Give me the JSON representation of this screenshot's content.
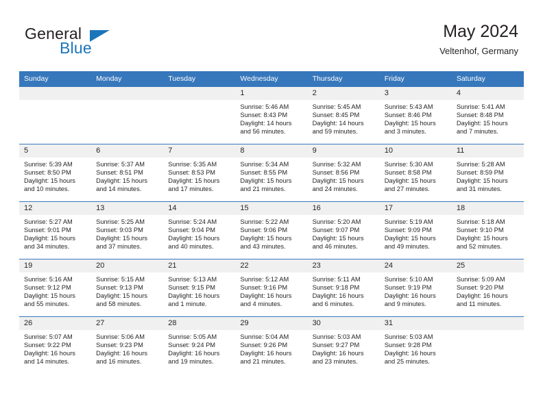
{
  "brand": {
    "word_one": "General",
    "word_two": "Blue",
    "logo_icon": "blue-triangle-logo"
  },
  "header": {
    "title": "May 2024",
    "subtitle": "Veltenhof, Germany"
  },
  "theme": {
    "header_blue": "#3777bc",
    "brand_blue": "#1b75bb",
    "daynum_bg": "#f0f0f0",
    "text": "#231f20"
  },
  "calendar": {
    "weekday_headers": [
      "Sunday",
      "Monday",
      "Tuesday",
      "Wednesday",
      "Thursday",
      "Friday",
      "Saturday"
    ],
    "weeks": [
      [
        {
          "day": "",
          "empty": true,
          "sunrise": "",
          "sunset": "",
          "daylight_line1": "",
          "daylight_line2": ""
        },
        {
          "day": "",
          "empty": true,
          "sunrise": "",
          "sunset": "",
          "daylight_line1": "",
          "daylight_line2": ""
        },
        {
          "day": "",
          "empty": true,
          "sunrise": "",
          "sunset": "",
          "daylight_line1": "",
          "daylight_line2": ""
        },
        {
          "day": "1",
          "empty": false,
          "sunrise": "Sunrise: 5:46 AM",
          "sunset": "Sunset: 8:43 PM",
          "daylight_line1": "Daylight: 14 hours",
          "daylight_line2": "and 56 minutes."
        },
        {
          "day": "2",
          "empty": false,
          "sunrise": "Sunrise: 5:45 AM",
          "sunset": "Sunset: 8:45 PM",
          "daylight_line1": "Daylight: 14 hours",
          "daylight_line2": "and 59 minutes."
        },
        {
          "day": "3",
          "empty": false,
          "sunrise": "Sunrise: 5:43 AM",
          "sunset": "Sunset: 8:46 PM",
          "daylight_line1": "Daylight: 15 hours",
          "daylight_line2": "and 3 minutes."
        },
        {
          "day": "4",
          "empty": false,
          "sunrise": "Sunrise: 5:41 AM",
          "sunset": "Sunset: 8:48 PM",
          "daylight_line1": "Daylight: 15 hours",
          "daylight_line2": "and 7 minutes."
        }
      ],
      [
        {
          "day": "5",
          "empty": false,
          "sunrise": "Sunrise: 5:39 AM",
          "sunset": "Sunset: 8:50 PM",
          "daylight_line1": "Daylight: 15 hours",
          "daylight_line2": "and 10 minutes."
        },
        {
          "day": "6",
          "empty": false,
          "sunrise": "Sunrise: 5:37 AM",
          "sunset": "Sunset: 8:51 PM",
          "daylight_line1": "Daylight: 15 hours",
          "daylight_line2": "and 14 minutes."
        },
        {
          "day": "7",
          "empty": false,
          "sunrise": "Sunrise: 5:35 AM",
          "sunset": "Sunset: 8:53 PM",
          "daylight_line1": "Daylight: 15 hours",
          "daylight_line2": "and 17 minutes."
        },
        {
          "day": "8",
          "empty": false,
          "sunrise": "Sunrise: 5:34 AM",
          "sunset": "Sunset: 8:55 PM",
          "daylight_line1": "Daylight: 15 hours",
          "daylight_line2": "and 21 minutes."
        },
        {
          "day": "9",
          "empty": false,
          "sunrise": "Sunrise: 5:32 AM",
          "sunset": "Sunset: 8:56 PM",
          "daylight_line1": "Daylight: 15 hours",
          "daylight_line2": "and 24 minutes."
        },
        {
          "day": "10",
          "empty": false,
          "sunrise": "Sunrise: 5:30 AM",
          "sunset": "Sunset: 8:58 PM",
          "daylight_line1": "Daylight: 15 hours",
          "daylight_line2": "and 27 minutes."
        },
        {
          "day": "11",
          "empty": false,
          "sunrise": "Sunrise: 5:28 AM",
          "sunset": "Sunset: 8:59 PM",
          "daylight_line1": "Daylight: 15 hours",
          "daylight_line2": "and 31 minutes."
        }
      ],
      [
        {
          "day": "12",
          "empty": false,
          "sunrise": "Sunrise: 5:27 AM",
          "sunset": "Sunset: 9:01 PM",
          "daylight_line1": "Daylight: 15 hours",
          "daylight_line2": "and 34 minutes."
        },
        {
          "day": "13",
          "empty": false,
          "sunrise": "Sunrise: 5:25 AM",
          "sunset": "Sunset: 9:03 PM",
          "daylight_line1": "Daylight: 15 hours",
          "daylight_line2": "and 37 minutes."
        },
        {
          "day": "14",
          "empty": false,
          "sunrise": "Sunrise: 5:24 AM",
          "sunset": "Sunset: 9:04 PM",
          "daylight_line1": "Daylight: 15 hours",
          "daylight_line2": "and 40 minutes."
        },
        {
          "day": "15",
          "empty": false,
          "sunrise": "Sunrise: 5:22 AM",
          "sunset": "Sunset: 9:06 PM",
          "daylight_line1": "Daylight: 15 hours",
          "daylight_line2": "and 43 minutes."
        },
        {
          "day": "16",
          "empty": false,
          "sunrise": "Sunrise: 5:20 AM",
          "sunset": "Sunset: 9:07 PM",
          "daylight_line1": "Daylight: 15 hours",
          "daylight_line2": "and 46 minutes."
        },
        {
          "day": "17",
          "empty": false,
          "sunrise": "Sunrise: 5:19 AM",
          "sunset": "Sunset: 9:09 PM",
          "daylight_line1": "Daylight: 15 hours",
          "daylight_line2": "and 49 minutes."
        },
        {
          "day": "18",
          "empty": false,
          "sunrise": "Sunrise: 5:18 AM",
          "sunset": "Sunset: 9:10 PM",
          "daylight_line1": "Daylight: 15 hours",
          "daylight_line2": "and 52 minutes."
        }
      ],
      [
        {
          "day": "19",
          "empty": false,
          "sunrise": "Sunrise: 5:16 AM",
          "sunset": "Sunset: 9:12 PM",
          "daylight_line1": "Daylight: 15 hours",
          "daylight_line2": "and 55 minutes."
        },
        {
          "day": "20",
          "empty": false,
          "sunrise": "Sunrise: 5:15 AM",
          "sunset": "Sunset: 9:13 PM",
          "daylight_line1": "Daylight: 15 hours",
          "daylight_line2": "and 58 minutes."
        },
        {
          "day": "21",
          "empty": false,
          "sunrise": "Sunrise: 5:13 AM",
          "sunset": "Sunset: 9:15 PM",
          "daylight_line1": "Daylight: 16 hours",
          "daylight_line2": "and 1 minute."
        },
        {
          "day": "22",
          "empty": false,
          "sunrise": "Sunrise: 5:12 AM",
          "sunset": "Sunset: 9:16 PM",
          "daylight_line1": "Daylight: 16 hours",
          "daylight_line2": "and 4 minutes."
        },
        {
          "day": "23",
          "empty": false,
          "sunrise": "Sunrise: 5:11 AM",
          "sunset": "Sunset: 9:18 PM",
          "daylight_line1": "Daylight: 16 hours",
          "daylight_line2": "and 6 minutes."
        },
        {
          "day": "24",
          "empty": false,
          "sunrise": "Sunrise: 5:10 AM",
          "sunset": "Sunset: 9:19 PM",
          "daylight_line1": "Daylight: 16 hours",
          "daylight_line2": "and 9 minutes."
        },
        {
          "day": "25",
          "empty": false,
          "sunrise": "Sunrise: 5:09 AM",
          "sunset": "Sunset: 9:20 PM",
          "daylight_line1": "Daylight: 16 hours",
          "daylight_line2": "and 11 minutes."
        }
      ],
      [
        {
          "day": "26",
          "empty": false,
          "sunrise": "Sunrise: 5:07 AM",
          "sunset": "Sunset: 9:22 PM",
          "daylight_line1": "Daylight: 16 hours",
          "daylight_line2": "and 14 minutes."
        },
        {
          "day": "27",
          "empty": false,
          "sunrise": "Sunrise: 5:06 AM",
          "sunset": "Sunset: 9:23 PM",
          "daylight_line1": "Daylight: 16 hours",
          "daylight_line2": "and 16 minutes."
        },
        {
          "day": "28",
          "empty": false,
          "sunrise": "Sunrise: 5:05 AM",
          "sunset": "Sunset: 9:24 PM",
          "daylight_line1": "Daylight: 16 hours",
          "daylight_line2": "and 19 minutes."
        },
        {
          "day": "29",
          "empty": false,
          "sunrise": "Sunrise: 5:04 AM",
          "sunset": "Sunset: 9:26 PM",
          "daylight_line1": "Daylight: 16 hours",
          "daylight_line2": "and 21 minutes."
        },
        {
          "day": "30",
          "empty": false,
          "sunrise": "Sunrise: 5:03 AM",
          "sunset": "Sunset: 9:27 PM",
          "daylight_line1": "Daylight: 16 hours",
          "daylight_line2": "and 23 minutes."
        },
        {
          "day": "31",
          "empty": false,
          "sunrise": "Sunrise: 5:03 AM",
          "sunset": "Sunset: 9:28 PM",
          "daylight_line1": "Daylight: 16 hours",
          "daylight_line2": "and 25 minutes."
        },
        {
          "day": "",
          "empty": true,
          "sunrise": "",
          "sunset": "",
          "daylight_line1": "",
          "daylight_line2": ""
        }
      ]
    ]
  }
}
